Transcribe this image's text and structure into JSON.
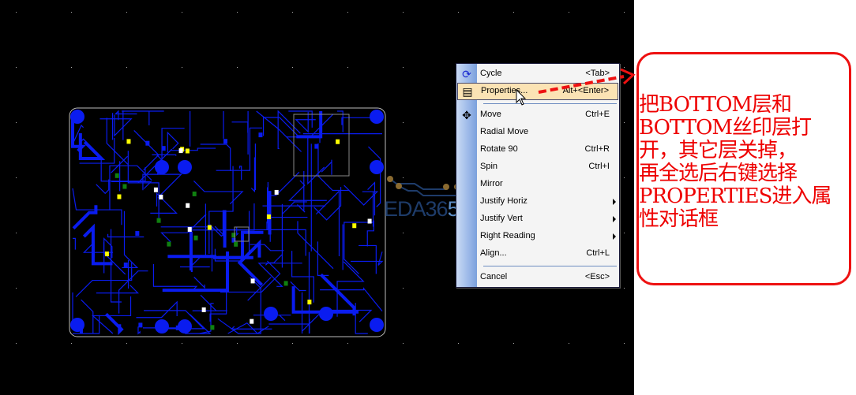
{
  "watermark": {
    "text_dark": "EDA36",
    "text_light": "5"
  },
  "context_menu": {
    "items": [
      {
        "label": "Cycle",
        "shortcut": "<Tab>",
        "icon": "cycle-icon"
      },
      {
        "label": "Properties...",
        "shortcut": "Alt+<Enter>",
        "icon": "properties-icon",
        "highlighted": true
      },
      {
        "label": "Move",
        "shortcut": "Ctrl+E",
        "icon": "move-icon"
      },
      {
        "label": "Radial Move",
        "shortcut": ""
      },
      {
        "label": "Rotate 90",
        "shortcut": "Ctrl+R"
      },
      {
        "label": "Spin",
        "shortcut": "Ctrl+I"
      },
      {
        "label": "Mirror",
        "shortcut": ""
      },
      {
        "label": "Justify Horiz",
        "submenu": true
      },
      {
        "label": "Justify Vert",
        "submenu": true
      },
      {
        "label": "Right Reading",
        "submenu": true
      },
      {
        "label": "Align...",
        "shortcut": "Ctrl+L"
      },
      {
        "label": "Cancel",
        "shortcut": "<Esc>"
      }
    ]
  },
  "annotation": {
    "text": "把BOTTOM层和\nBOTTOM丝印层打\n开，其它层关掉，\n再全选后右键选择\nPROPERTIES进入属\n性对话框",
    "color": "#ee0000"
  },
  "colors": {
    "trace": "#0a1cf0",
    "background": "#000000",
    "highlight": "#fbe3b4"
  }
}
